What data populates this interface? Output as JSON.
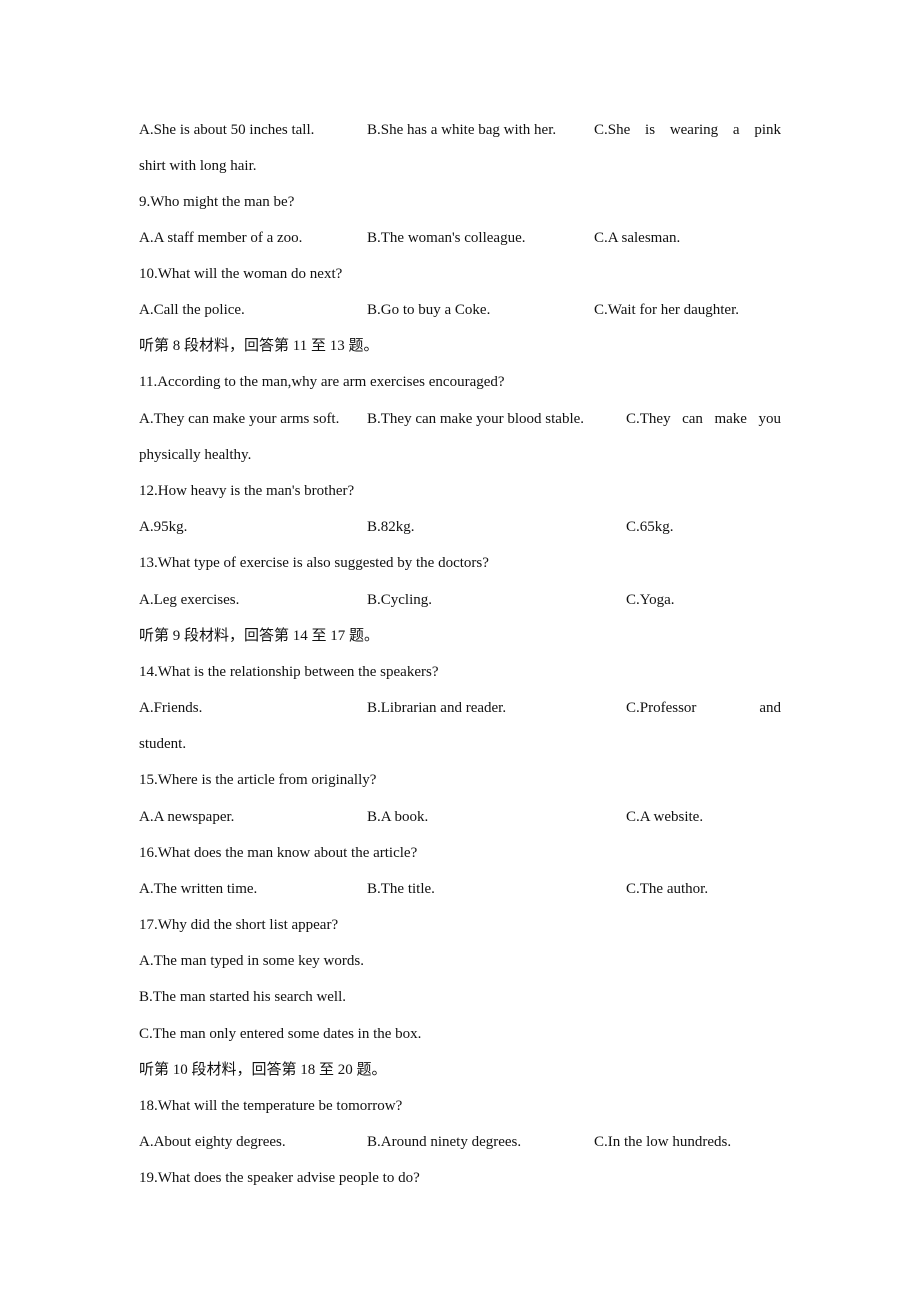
{
  "document": {
    "q8_options": {
      "A": "A.She is about 50 inches tall.",
      "B": "B.She has a white bag with her.",
      "C_line1_words": [
        "C.She",
        "is",
        "wearing",
        "a",
        "pink"
      ],
      "C_line2": "shirt with long hair."
    },
    "q9": {
      "question": "9.Who might the man be?",
      "A": "A.A staff member of a zoo.",
      "B": "B.The woman's colleague.",
      "C": "C.A salesman."
    },
    "q10": {
      "question": "10.What will the woman do next?",
      "A": "A.Call the police.",
      "B": "B.Go to buy a Coke.",
      "C": "C.Wait for her daughter."
    },
    "section8": "听第 8 段材料，回答第 11 至 13 题。",
    "q11": {
      "question": "11.According to the man,why are arm exercises encouraged?",
      "A": "A.They can make your arms soft.",
      "B": "B.They can make your blood stable.",
      "C_line1_words": [
        "C.They",
        "can",
        "make",
        "you"
      ],
      "C_line2": "physically healthy."
    },
    "q12": {
      "question": "12.How heavy is the man's brother?",
      "A": "A.95kg.",
      "B": "B.82kg.",
      "C": "C.65kg."
    },
    "q13": {
      "question": "13.What type of exercise is also suggested by the doctors?",
      "A": "A.Leg exercises.",
      "B": "B.Cycling.",
      "C": "C.Yoga."
    },
    "section9": "听第 9 段材料，回答第 14 至 17 题。",
    "q14": {
      "question": "14.What is the relationship between the speakers?",
      "A": "A.Friends.",
      "B": "B.Librarian and reader.",
      "C_line1_words": [
        "C.Professor",
        "and"
      ],
      "C_line2": "student."
    },
    "q15": {
      "question": "15.Where is the article from originally?",
      "A": "A.A newspaper.",
      "B": "B.A book.",
      "C": "C.A website."
    },
    "q16": {
      "question": "16.What does the man know about the article?",
      "A": "A.The written time.",
      "B": "B.The title.",
      "C": "C.The author."
    },
    "q17": {
      "question": "17.Why did the short list appear?",
      "A": "A.The man typed in some key words.",
      "B": "B.The man started his search well.",
      "C": "C.The man only entered some dates in the box."
    },
    "section10": "听第 10 段材料，回答第 18 至 20 题。",
    "q18": {
      "question": "18.What will the temperature be tomorrow?",
      "A": "A.About eighty degrees.",
      "B": "B.Around ninety degrees.",
      "C": "C.In the low hundreds."
    },
    "q19": {
      "question": "19.What does the speaker advise people to do?"
    }
  }
}
